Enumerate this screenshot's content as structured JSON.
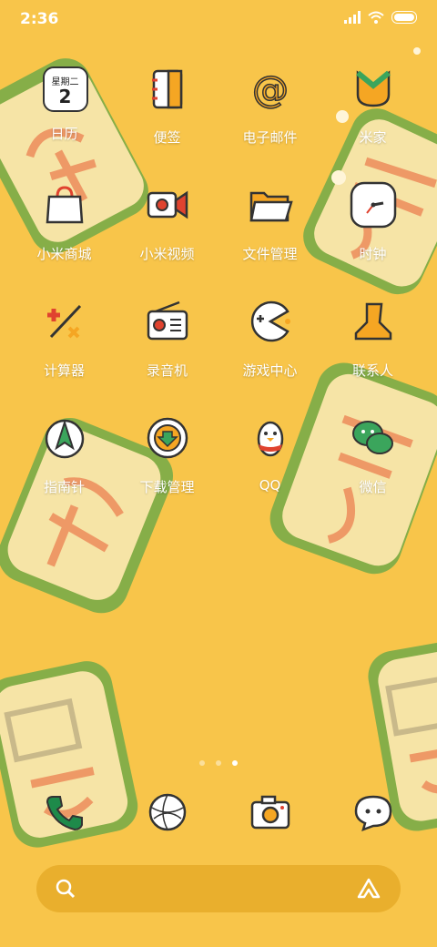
{
  "status": {
    "time": "2:36"
  },
  "apps": [
    {
      "label": "日历",
      "icon": "calendar-icon",
      "cal_top": "星期二",
      "cal_day": "2"
    },
    {
      "label": "便签",
      "icon": "notes-icon"
    },
    {
      "label": "电子邮件",
      "icon": "email-icon"
    },
    {
      "label": "米家",
      "icon": "mijia-icon"
    },
    {
      "label": "小米商城",
      "icon": "shopping-bag-icon"
    },
    {
      "label": "小米视频",
      "icon": "video-camera-icon"
    },
    {
      "label": "文件管理",
      "icon": "folder-icon"
    },
    {
      "label": "时钟",
      "icon": "clock-icon"
    },
    {
      "label": "计算器",
      "icon": "calculator-icon"
    },
    {
      "label": "录音机",
      "icon": "radio-recorder-icon"
    },
    {
      "label": "游戏中心",
      "icon": "game-controller-icon"
    },
    {
      "label": "联系人",
      "icon": "contact-person-icon"
    },
    {
      "label": "指南针",
      "icon": "compass-icon"
    },
    {
      "label": "下载管理",
      "icon": "download-icon"
    },
    {
      "label": "QQ",
      "icon": "qq-penguin-icon"
    },
    {
      "label": "微信",
      "icon": "wechat-icon"
    }
  ],
  "dock": [
    {
      "icon": "phone-icon"
    },
    {
      "icon": "browser-globe-icon"
    },
    {
      "icon": "camera-icon"
    },
    {
      "icon": "messages-icon"
    }
  ],
  "pages": {
    "count": 3,
    "current": 3
  },
  "colors": {
    "background": "#F8C54A",
    "tile_green": "#8BB04A",
    "tile_face": "#F6E4A6",
    "accent_red": "#E0432F"
  }
}
